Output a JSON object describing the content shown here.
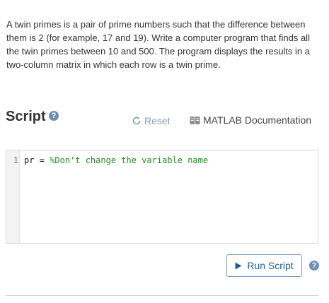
{
  "problem": {
    "text": "A twin primes is a pair of prime numbers such that the difference between them is 2 (for example, 17 and 19). Write a computer program that finds all the twin primes between 10 and 500. The program displays the results in a two-column matrix in which each row is a twin prime."
  },
  "script_section": {
    "title": "Script",
    "help_glyph": "?",
    "reset_label": "Reset",
    "docs_label": "MATLAB Documentation"
  },
  "editor": {
    "line_number": "1",
    "code_prefix": "pr = ",
    "code_comment": "%Don't change the variable name"
  },
  "actions": {
    "run_label": "Run Script",
    "help_glyph": "?"
  },
  "colors": {
    "accent": "#1f5d97",
    "help_icon": "#6d8fb3",
    "comment": "#228b22"
  }
}
